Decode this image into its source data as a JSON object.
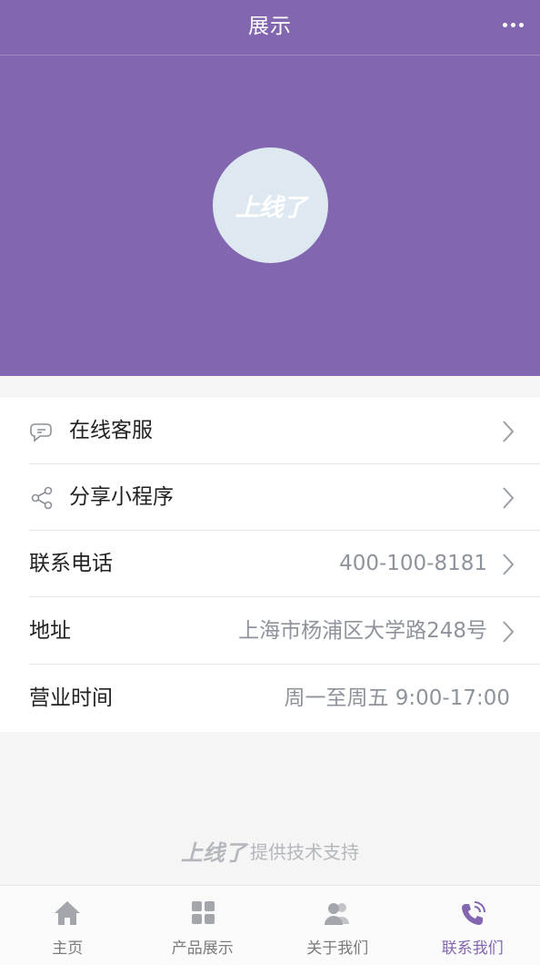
{
  "header": {
    "title": "展示",
    "more_icon": "more-dots-icon"
  },
  "hero": {
    "logo_text": "上线了",
    "background": "#8266b0"
  },
  "list": [
    {
      "icon": "chat-bubble-icon",
      "label": "在线客服",
      "value": ""
    },
    {
      "icon": "share-icon",
      "label": "分享小程序",
      "value": ""
    },
    {
      "icon": "",
      "label": "联系电话",
      "value": "400-100-8181"
    },
    {
      "icon": "",
      "label": "地址",
      "value": "上海市杨浦区大学路248号"
    },
    {
      "icon": "",
      "label": "营业时间",
      "value": "周一至周五 9:00-17:00"
    }
  ],
  "credit": {
    "logo": "上线了",
    "text": "提供技术支持"
  },
  "tabs": [
    {
      "icon": "home-icon",
      "label": "主页",
      "active": false
    },
    {
      "icon": "grid-icon",
      "label": "产品展示",
      "active": false
    },
    {
      "icon": "people-icon",
      "label": "关于我们",
      "active": false
    },
    {
      "icon": "phone-icon",
      "label": "联系我们",
      "active": true
    }
  ],
  "colors": {
    "accent": "#8266b0",
    "muted_text": "#8e939c",
    "tab_inactive": "#7c7c7c"
  }
}
